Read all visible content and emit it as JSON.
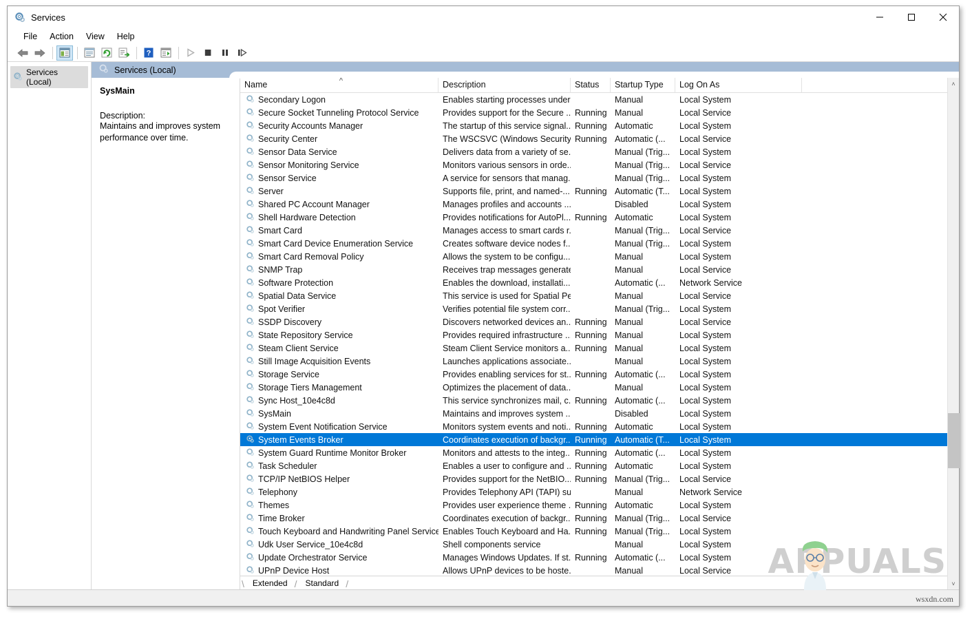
{
  "window": {
    "title": "Services",
    "icon": "services-gear-icon",
    "controls": {
      "minimize": "—",
      "maximize": "☐",
      "close": "✕"
    }
  },
  "menu": {
    "items": [
      "File",
      "Action",
      "View",
      "Help"
    ]
  },
  "toolbar": {
    "buttons": [
      {
        "name": "back-button",
        "glyph": "⬅",
        "enabled": true
      },
      {
        "name": "forward-button",
        "glyph": "➡",
        "enabled": true
      },
      {
        "name": "show-hide-console-tree-button",
        "glyph": "tree-icon",
        "enabled": true,
        "active": true
      },
      {
        "name": "properties-button",
        "glyph": "properties-icon",
        "enabled": true
      },
      {
        "name": "refresh-button",
        "glyph": "refresh-icon",
        "enabled": true
      },
      {
        "name": "export-list-button",
        "glyph": "export-icon",
        "enabled": true
      },
      {
        "name": "help-button",
        "glyph": "?",
        "enabled": true
      },
      {
        "name": "show-action-pane-button",
        "glyph": "action-pane-icon",
        "enabled": true
      },
      {
        "name": "start-service-button",
        "glyph": "▶",
        "enabled": false
      },
      {
        "name": "stop-service-button",
        "glyph": "■",
        "enabled": false
      },
      {
        "name": "pause-service-button",
        "glyph": "⏸",
        "enabled": false
      },
      {
        "name": "restart-service-button",
        "glyph": "⏭",
        "enabled": false
      }
    ]
  },
  "tree": {
    "root_label": "Services (Local)",
    "root_icon": "services-gear-icon"
  },
  "pane_header": {
    "label": "Services (Local)",
    "icon": "services-gear-icon"
  },
  "details": {
    "service_name": "SysMain",
    "description_label": "Description:",
    "description_text": "Maintains and improves system performance over time."
  },
  "list": {
    "columns": [
      {
        "key": "name",
        "label": "Name",
        "sorted": "asc",
        "sort_glyph": "˄"
      },
      {
        "key": "description",
        "label": "Description"
      },
      {
        "key": "status",
        "label": "Status"
      },
      {
        "key": "startup",
        "label": "Startup Type"
      },
      {
        "key": "logon",
        "label": "Log On As"
      }
    ],
    "selected_index": 26,
    "rows": [
      {
        "name": "Secondary Logon",
        "description": "Enables starting processes under...",
        "status": "",
        "startup": "Manual",
        "logon": "Local System"
      },
      {
        "name": "Secure Socket Tunneling Protocol Service",
        "description": "Provides support for the Secure ...",
        "status": "Running",
        "startup": "Manual",
        "logon": "Local Service"
      },
      {
        "name": "Security Accounts Manager",
        "description": "The startup of this service signal...",
        "status": "Running",
        "startup": "Automatic",
        "logon": "Local System"
      },
      {
        "name": "Security Center",
        "description": "The WSCSVC (Windows Security ...",
        "status": "Running",
        "startup": "Automatic (...",
        "logon": "Local Service"
      },
      {
        "name": "Sensor Data Service",
        "description": "Delivers data from a variety of se...",
        "status": "",
        "startup": "Manual (Trig...",
        "logon": "Local System"
      },
      {
        "name": "Sensor Monitoring Service",
        "description": "Monitors various sensors in orde...",
        "status": "",
        "startup": "Manual (Trig...",
        "logon": "Local Service"
      },
      {
        "name": "Sensor Service",
        "description": "A service for sensors that manag...",
        "status": "",
        "startup": "Manual (Trig...",
        "logon": "Local System"
      },
      {
        "name": "Server",
        "description": "Supports file, print, and named-...",
        "status": "Running",
        "startup": "Automatic (T...",
        "logon": "Local System"
      },
      {
        "name": "Shared PC Account Manager",
        "description": "Manages profiles and accounts ...",
        "status": "",
        "startup": "Disabled",
        "logon": "Local System"
      },
      {
        "name": "Shell Hardware Detection",
        "description": "Provides notifications for AutoPl...",
        "status": "Running",
        "startup": "Automatic",
        "logon": "Local System"
      },
      {
        "name": "Smart Card",
        "description": "Manages access to smart cards r...",
        "status": "",
        "startup": "Manual (Trig...",
        "logon": "Local Service"
      },
      {
        "name": "Smart Card Device Enumeration Service",
        "description": "Creates software device nodes f...",
        "status": "",
        "startup": "Manual (Trig...",
        "logon": "Local System"
      },
      {
        "name": "Smart Card Removal Policy",
        "description": "Allows the system to be configu...",
        "status": "",
        "startup": "Manual",
        "logon": "Local System"
      },
      {
        "name": "SNMP Trap",
        "description": "Receives trap messages generate...",
        "status": "",
        "startup": "Manual",
        "logon": "Local Service"
      },
      {
        "name": "Software Protection",
        "description": "Enables the download, installati...",
        "status": "",
        "startup": "Automatic (...",
        "logon": "Network Service"
      },
      {
        "name": "Spatial Data Service",
        "description": "This service is used for Spatial Pe...",
        "status": "",
        "startup": "Manual",
        "logon": "Local Service"
      },
      {
        "name": "Spot Verifier",
        "description": "Verifies potential file system corr...",
        "status": "",
        "startup": "Manual (Trig...",
        "logon": "Local System"
      },
      {
        "name": "SSDP Discovery",
        "description": "Discovers networked devices an...",
        "status": "Running",
        "startup": "Manual",
        "logon": "Local Service"
      },
      {
        "name": "State Repository Service",
        "description": "Provides required infrastructure ...",
        "status": "Running",
        "startup": "Manual",
        "logon": "Local System"
      },
      {
        "name": "Steam Client Service",
        "description": "Steam Client Service monitors a...",
        "status": "Running",
        "startup": "Manual",
        "logon": "Local System"
      },
      {
        "name": "Still Image Acquisition Events",
        "description": "Launches applications associate...",
        "status": "",
        "startup": "Manual",
        "logon": "Local System"
      },
      {
        "name": "Storage Service",
        "description": "Provides enabling services for st...",
        "status": "Running",
        "startup": "Automatic (...",
        "logon": "Local System"
      },
      {
        "name": "Storage Tiers Management",
        "description": "Optimizes the placement of data...",
        "status": "",
        "startup": "Manual",
        "logon": "Local System"
      },
      {
        "name": "Sync Host_10e4c8d",
        "description": "This service synchronizes mail, c...",
        "status": "Running",
        "startup": "Automatic (...",
        "logon": "Local System"
      },
      {
        "name": "SysMain",
        "description": "Maintains and improves system ...",
        "status": "",
        "startup": "Disabled",
        "logon": "Local System"
      },
      {
        "name": "System Event Notification Service",
        "description": "Monitors system events and noti...",
        "status": "Running",
        "startup": "Automatic",
        "logon": "Local System"
      },
      {
        "name": "System Events Broker",
        "description": "Coordinates execution of backgr...",
        "status": "Running",
        "startup": "Automatic (T...",
        "logon": "Local System"
      },
      {
        "name": "System Guard Runtime Monitor Broker",
        "description": "Monitors and attests to the integ...",
        "status": "Running",
        "startup": "Automatic (...",
        "logon": "Local System"
      },
      {
        "name": "Task Scheduler",
        "description": "Enables a user to configure and ...",
        "status": "Running",
        "startup": "Automatic",
        "logon": "Local System"
      },
      {
        "name": "TCP/IP NetBIOS Helper",
        "description": "Provides support for the NetBIO...",
        "status": "Running",
        "startup": "Manual (Trig...",
        "logon": "Local Service"
      },
      {
        "name": "Telephony",
        "description": "Provides Telephony API (TAPI) su...",
        "status": "",
        "startup": "Manual",
        "logon": "Network Service"
      },
      {
        "name": "Themes",
        "description": "Provides user experience theme ...",
        "status": "Running",
        "startup": "Automatic",
        "logon": "Local System"
      },
      {
        "name": "Time Broker",
        "description": "Coordinates execution of backgr...",
        "status": "Running",
        "startup": "Manual (Trig...",
        "logon": "Local Service"
      },
      {
        "name": "Touch Keyboard and Handwriting Panel Service",
        "description": "Enables Touch Keyboard and Ha...",
        "status": "Running",
        "startup": "Manual (Trig...",
        "logon": "Local System"
      },
      {
        "name": "Udk User Service_10e4c8d",
        "description": "Shell components service",
        "status": "",
        "startup": "Manual",
        "logon": "Local System"
      },
      {
        "name": "Update Orchestrator Service",
        "description": "Manages Windows Updates. If st...",
        "status": "Running",
        "startup": "Automatic (...",
        "logon": "Local System"
      },
      {
        "name": "UPnP Device Host",
        "description": "Allows UPnP devices to be hoste...",
        "status": "",
        "startup": "Manual",
        "logon": "Local Service"
      }
    ]
  },
  "tabs": {
    "items": [
      "Extended",
      "Standard"
    ],
    "active": "Standard"
  },
  "scrollbar": {
    "up_glyph": "˄",
    "down_glyph": "˅"
  },
  "watermark": {
    "text": "APPUALS",
    "site": "wsxdn.com"
  },
  "colors": {
    "selection": "#0078d7",
    "pane_header": "#a6bcd6",
    "toolbar_active": "#cfe6f7",
    "watermark": "#cfcfcf"
  }
}
